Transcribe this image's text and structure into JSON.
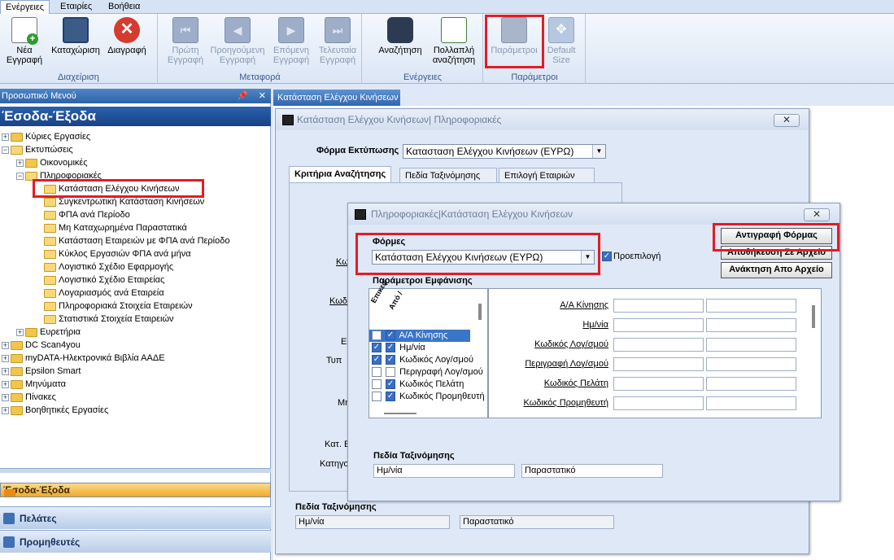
{
  "menubar": {
    "tabs": [
      "Ενέργειες",
      "Εταιρίες",
      "Βοήθεια"
    ]
  },
  "ribbon": {
    "groups": [
      {
        "caption": "Διαχείριση",
        "buttons": [
          {
            "line1": "Νέα",
            "line2": "Εγγραφή"
          },
          {
            "line1": "Καταχώριση",
            "line2": ""
          },
          {
            "line1": "Διαγραφή",
            "line2": ""
          }
        ]
      },
      {
        "caption": "Μεταφορά",
        "buttons": [
          {
            "line1": "Πρώτη",
            "line2": "Εγγραφή"
          },
          {
            "line1": "Προηγούμενη",
            "line2": "Εγγραφή"
          },
          {
            "line1": "Επόμενη",
            "line2": "Εγγραφή"
          },
          {
            "line1": "Τελευταία",
            "line2": "Εγγραφή"
          }
        ]
      },
      {
        "caption": "Ενέργειες",
        "buttons": [
          {
            "line1": "Αναζήτηση",
            "line2": ""
          },
          {
            "line1": "Πολλαπλή",
            "line2": "αναζήτηση"
          }
        ]
      },
      {
        "caption": "Παράμετροι",
        "buttons": [
          {
            "line1": "Παράμετροι",
            "line2": ""
          },
          {
            "line1": "Default",
            "line2": "Size"
          }
        ]
      }
    ]
  },
  "sidebar": {
    "header": "Προσωπικό Μενού",
    "pin": "ᵖ",
    "close": "✕",
    "title": "Έσοδα-Έξοδα",
    "tree": [
      {
        "label": "Κύριες Εργασίες",
        "toggle": "+"
      },
      {
        "label": "Εκτυπώσεις",
        "toggle": "−"
      },
      {
        "label": "Οικονομικές",
        "toggle": "+"
      },
      {
        "label": "Πληροφοριακές",
        "toggle": "−"
      },
      {
        "label": "Κατάσταση Ελέγχου Κινήσεων"
      },
      {
        "label": "Συγκεντρωτική Κατάσταση Κινήσεων"
      },
      {
        "label": "ΦΠΑ ανά Περίοδο"
      },
      {
        "label": "Μη Καταχωρημένα Παραστατικά"
      },
      {
        "label": "Κατάσταση Εταιρειών με ΦΠΑ ανά Περίοδο"
      },
      {
        "label": "Κύκλος Εργασιών ΦΠΑ ανά μήνα"
      },
      {
        "label": "Λογιστικό Σχέδιο Εφαρμογής"
      },
      {
        "label": "Λογιστικό Σχέδιο Εταιρείας"
      },
      {
        "label": "Λογαριασμός ανά Εταιρεία"
      },
      {
        "label": "Πληροφοριακά Στοιχεία Εταιρειών"
      },
      {
        "label": "Στατιστικά Στοιχεία Εταιρειών"
      },
      {
        "label": "Ευρετήρια",
        "toggle": "+"
      },
      {
        "label": "DC Scan4you",
        "toggle": "+"
      },
      {
        "label": "myDATA-Ηλεκτρονικά Βιβλία ΑΑΔΕ",
        "toggle": "+"
      },
      {
        "label": "Epsilon Smart",
        "toggle": "+"
      },
      {
        "label": "Μηνύματα",
        "toggle": "+"
      },
      {
        "label": "Πίνακες",
        "toggle": "+"
      },
      {
        "label": "Βοηθητικές Εργασίες",
        "toggle": "+"
      }
    ],
    "nav": [
      "Έσοδα-Έξοδα",
      "Πελάτες",
      "Προμηθευτές"
    ]
  },
  "doc_tab": "Κατάσταση Ελέγχου Κινήσεων",
  "main_window": {
    "title": "Κατάσταση Ελέγχου Κινήσεων| Πληροφοριακές",
    "close": "✕",
    "form_label": "Φόρμα Εκτύπωσης",
    "form_value": "Κατασταση Ελέγχου Κινήσεων (ΕΥΡΩ)",
    "tabs": [
      "Κριτήρια Αναζήτησης",
      "Πεδία Ταξινόμησης",
      "Επιλογή Εταιριών"
    ],
    "partial_labels": [
      "Κω",
      "Κωδι",
      "Ε",
      "Τυπ",
      "Μη",
      "Κατ. Ε",
      "Κατηγο"
    ],
    "sort_label": "Πεδία Ταξινόμησης",
    "sort_fields": [
      "Ημ/νία",
      "Παραστατικό"
    ]
  },
  "dialog": {
    "title": "Πληροφοριακές|Κατάσταση Ελέγχου Κινήσεων",
    "close": "✕",
    "forms_label": "Φόρμες",
    "forms_value": "Κατάσταση Ελέγχου Κινήσεων (ΕΥΡΩ)",
    "default_label": "Προεπιλογή",
    "buttons": [
      "Αντιγραφή Φόρμας",
      "Αποθήκευση Σε Αρχείο",
      "Ανάκτηση Απο Αρχείο"
    ],
    "display_params_label": "Παράμετροι Εμφάνισης",
    "col_headers": [
      "Επικεφ",
      "Από /"
    ],
    "fields": [
      {
        "label": "Α/Α Κίνησης",
        "c1": true,
        "c2": true
      },
      {
        "label": "Ημ/νία",
        "c1": true,
        "c2": true
      },
      {
        "label": "Κωδικός Λογ/σμού",
        "c1": true,
        "c2": true
      },
      {
        "label": "Περιγραφή Λογ/σμού",
        "c1": false,
        "c2": false
      },
      {
        "label": "Κωδικός Πελάτη",
        "c1": false,
        "c2": true
      },
      {
        "label": "Κωδικός Προμηθευτή",
        "c1": false,
        "c2": true
      }
    ],
    "sort_label": "Πεδία Ταξινόμησης",
    "sort_fields": [
      "Ημ/νία",
      "Παραστατικό"
    ]
  },
  "colors": {
    "highlight": "#e31c25",
    "accent": "#2d63a7",
    "selected_nav": "#f0a928"
  }
}
